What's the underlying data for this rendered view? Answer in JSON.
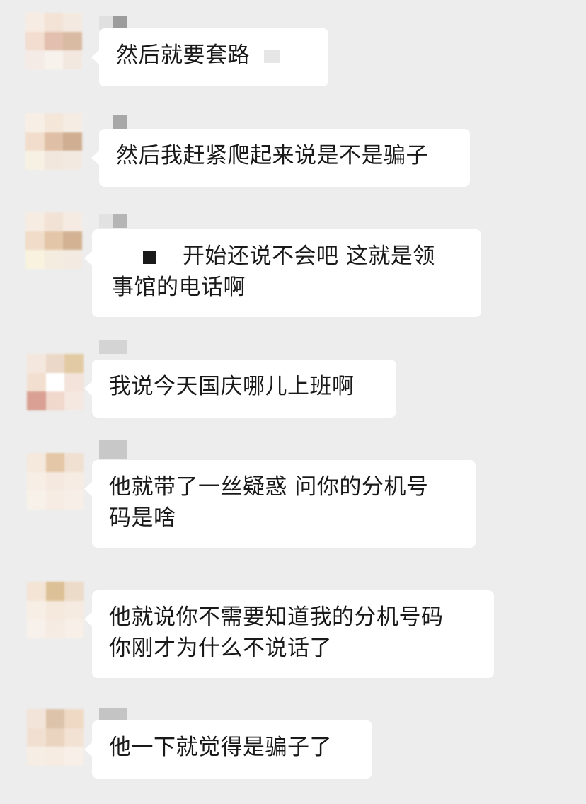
{
  "messages": [
    {
      "text": "然后就要套路"
    },
    {
      "text": "然后我赶紧爬起来说是不是骗子"
    },
    {
      "text": "开始还说不会吧 这就是领\n事馆的电话啊"
    },
    {
      "text": "我说今天国庆哪儿上班啊"
    },
    {
      "text": "他就带了一丝疑惑 问你的分机号\n码是啥"
    },
    {
      "text": "他就说你不需要知道我的分机号码\n你刚才为什么不说话了"
    },
    {
      "text": "他一下就觉得是骗子了"
    }
  ],
  "colors": {
    "background": "#ededed",
    "bubble": "#ffffff",
    "text": "#191919"
  },
  "icons": {
    "avatar": "blurred-avatar-icon",
    "redaction": "redaction-block-icon"
  }
}
